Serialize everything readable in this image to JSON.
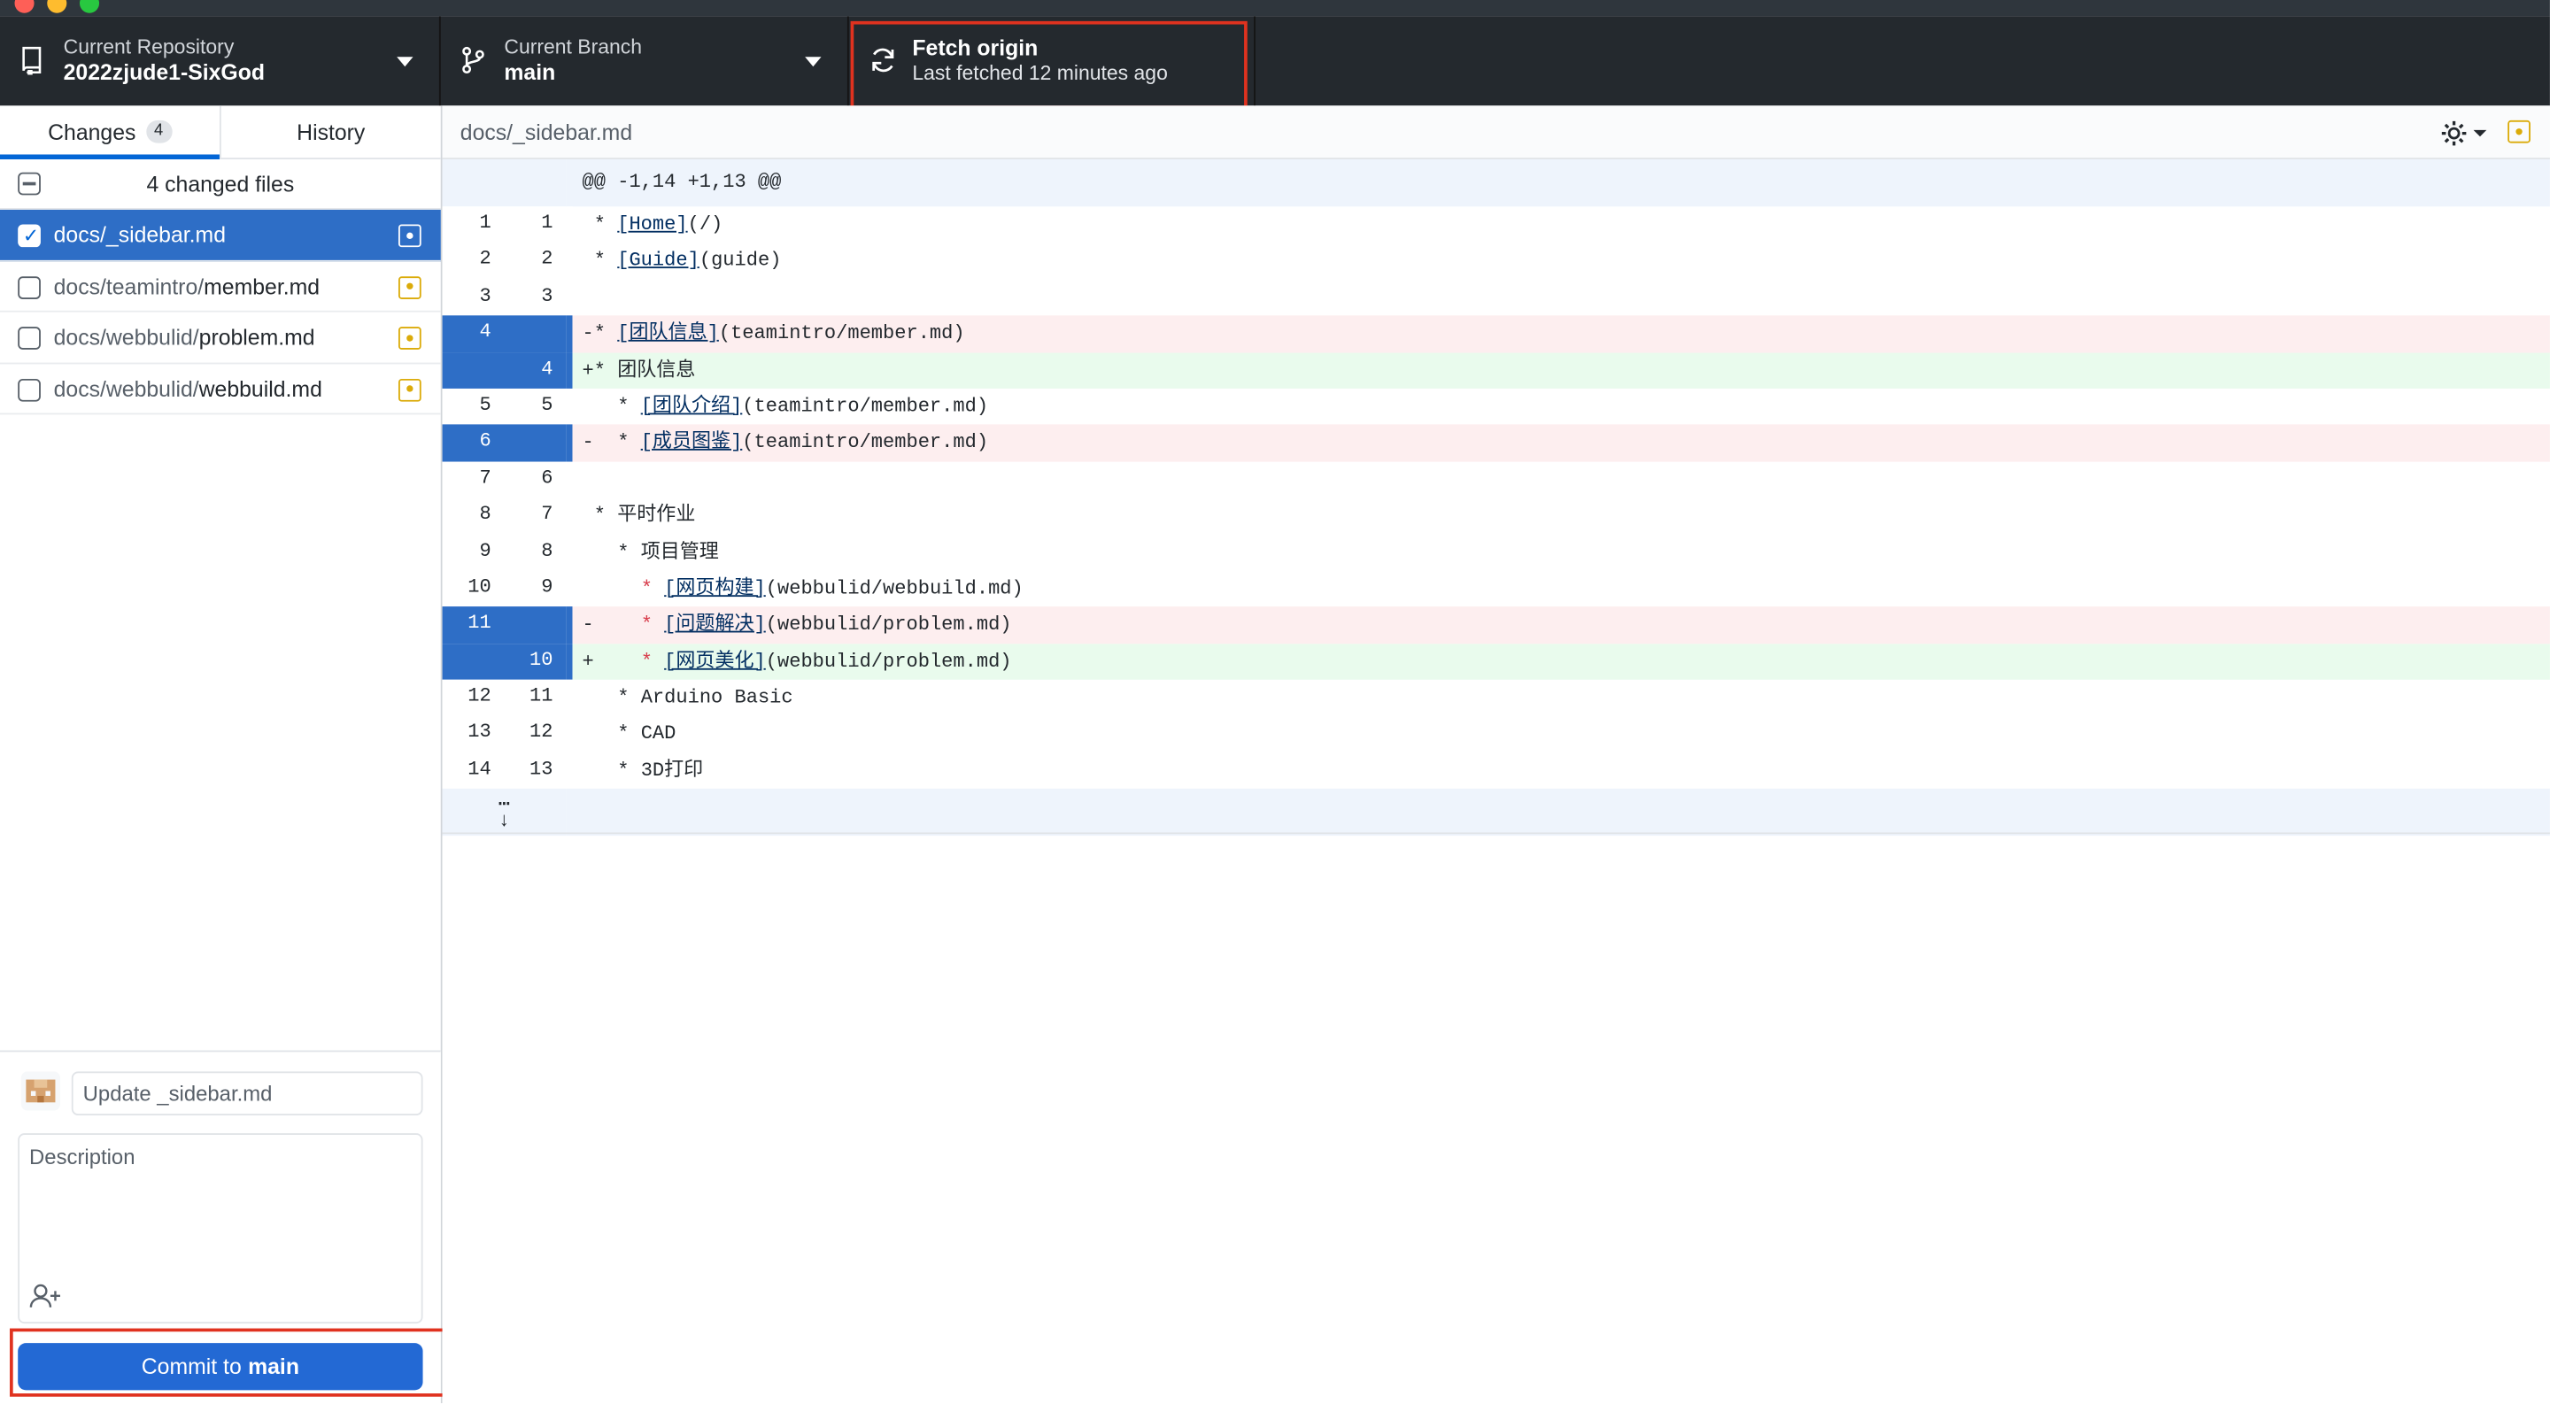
{
  "toolbar": {
    "repo_label": "Current Repository",
    "repo_value": "2022zjude1-SixGod",
    "branch_label": "Current Branch",
    "branch_value": "main",
    "fetch_title": "Fetch origin",
    "fetch_subtitle": "Last fetched 12 minutes ago"
  },
  "tabs": {
    "changes_label": "Changes",
    "changes_count": "4",
    "history_label": "History"
  },
  "files": {
    "header": "4 changed files",
    "items": [
      {
        "dir": "docs/",
        "name": "_sidebar.md"
      },
      {
        "dir": "docs/teamintro/",
        "name": "member.md"
      },
      {
        "dir": "docs/webbulid/",
        "name": "problem.md"
      },
      {
        "dir": "docs/webbulid/",
        "name": "webbuild.md"
      }
    ]
  },
  "commit": {
    "summary_placeholder": "Update _sidebar.md",
    "description_placeholder": "Description",
    "button_prefix": "Commit to",
    "button_branch": "main"
  },
  "diff": {
    "filename": "docs/_sidebar.md",
    "hunk_header": "@@ -1,14 +1,13 @@",
    "lines": [
      {
        "old": "1",
        "new": "1",
        "prefix": " ",
        "indent": "",
        "star": "* ",
        "link": "[Home]",
        "rest": "(/)"
      },
      {
        "old": "2",
        "new": "2",
        "prefix": " ",
        "indent": "",
        "star": "* ",
        "link": "[Guide]",
        "rest": "(guide)"
      },
      {
        "old": "3",
        "new": "3",
        "prefix": " ",
        "indent": "",
        "star": "",
        "link": "",
        "rest": ""
      },
      {
        "old": "4",
        "new": "",
        "prefix": "-",
        "indent": "",
        "star": "* ",
        "link": "[团队信息]",
        "rest": "(teamintro/member.md)"
      },
      {
        "old": "",
        "new": "4",
        "prefix": "+",
        "indent": "",
        "star": "* ",
        "link": "",
        "rest": "团队信息"
      },
      {
        "old": "5",
        "new": "5",
        "prefix": " ",
        "indent": "  ",
        "star": "* ",
        "link": "[团队介绍]",
        "rest": "(teamintro/member.md)"
      },
      {
        "old": "6",
        "new": "",
        "prefix": "-",
        "indent": "  ",
        "star": "* ",
        "link": "[成员图鉴]",
        "rest": "(teamintro/member.md)"
      },
      {
        "old": "7",
        "new": "6",
        "prefix": " ",
        "indent": "",
        "star": "",
        "link": "",
        "rest": ""
      },
      {
        "old": "8",
        "new": "7",
        "prefix": " ",
        "indent": "",
        "star": "* ",
        "link": "",
        "rest": "平时作业"
      },
      {
        "old": "9",
        "new": "8",
        "prefix": " ",
        "indent": "  ",
        "star": "* ",
        "link": "",
        "rest": "项目管理"
      },
      {
        "old": "10",
        "new": "9",
        "prefix": " ",
        "indent": "    ",
        "star": "* ",
        "link": "[网页构建]",
        "rest": "(webbulid/webbuild.md)"
      },
      {
        "old": "11",
        "new": "",
        "prefix": "-",
        "indent": "    ",
        "star": "* ",
        "link": "[问题解决]",
        "rest": "(webbulid/problem.md)"
      },
      {
        "old": "",
        "new": "10",
        "prefix": "+",
        "indent": "    ",
        "star": "* ",
        "link": "[网页美化]",
        "rest": "(webbulid/problem.md)"
      },
      {
        "old": "12",
        "new": "11",
        "prefix": " ",
        "indent": "  ",
        "star": "* ",
        "link": "",
        "rest": "Arduino Basic"
      },
      {
        "old": "13",
        "new": "12",
        "prefix": " ",
        "indent": "  ",
        "star": "* ",
        "link": "",
        "rest": "CAD"
      },
      {
        "old": "14",
        "new": "13",
        "prefix": " ",
        "indent": "  ",
        "star": "* ",
        "link": "",
        "rest": "3D打印"
      }
    ]
  },
  "colors": {
    "toolbar_bg": "#24292e",
    "selection_blue": "#2e6ec6",
    "commit_button": "#2369d4",
    "deleted_bg": "#fdeeef",
    "added_bg": "#e9fbed",
    "modified_icon": "#dbab09",
    "highlight_box": "#e0321f"
  }
}
